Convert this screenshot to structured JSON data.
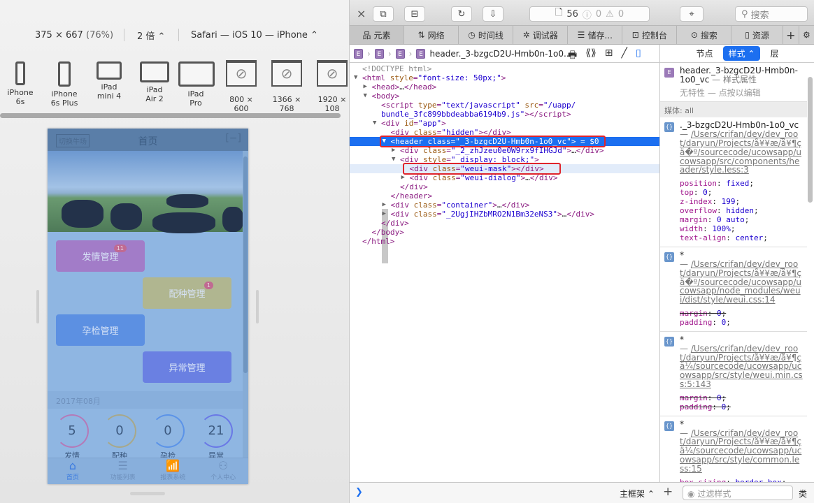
{
  "simulator": {
    "size": "375 × 667",
    "zoom": "(76%)",
    "scale": "2 倍 ⌃",
    "ua": "Safari — iOS 10 — iPhone ⌃",
    "devices": [
      {
        "l1": "iPhone",
        "l2": "6s"
      },
      {
        "l1": "iPhone",
        "l2": "6s Plus"
      },
      {
        "l1": "iPad",
        "l2": "mini 4"
      },
      {
        "l1": "iPad",
        "l2": "Air 2"
      },
      {
        "l1": "iPad",
        "l2": "Pro"
      },
      {
        "l1": "800 × 600",
        "l2": ""
      },
      {
        "l1": "1366 × 768",
        "l2": ""
      },
      {
        "l1": "1920 × 108",
        "l2": ""
      }
    ]
  },
  "app": {
    "switch_label": "切换牛场",
    "title": "首页",
    "logout_icon": "[−]",
    "menu": [
      {
        "label": "发情管理",
        "badge": "11",
        "color": "#a27cc8"
      },
      {
        "label": "配种管理",
        "badge": "1",
        "color": "#b0b690"
      },
      {
        "label": "孕检管理",
        "badge": "",
        "color": "#5c90e2"
      },
      {
        "label": "异常管理",
        "badge": "",
        "color": "#6a80e2"
      }
    ],
    "month": "2017年08月",
    "stats": [
      {
        "value": "5",
        "label": "发情",
        "color": "#b47ab8"
      },
      {
        "value": "0",
        "label": "配种",
        "color": "#a7a88a"
      },
      {
        "value": "0",
        "label": "孕检",
        "color": "#5b93e8"
      },
      {
        "value": "21",
        "label": "异常",
        "color": "#6a78e6"
      }
    ],
    "tabs": [
      {
        "label": "首页",
        "icon": "⌂",
        "active": true
      },
      {
        "label": "功能列表",
        "icon": "☰",
        "active": false
      },
      {
        "label": "报表系统",
        "icon": "📶",
        "active": false
      },
      {
        "label": "个人中心",
        "icon": "⚇",
        "active": false
      }
    ]
  },
  "devtools": {
    "close": "×",
    "resource_count": "56",
    "errors": "0",
    "warnings": "0",
    "search_placeholder": "搜索",
    "tabs": [
      "元素",
      "网络",
      "时间线",
      "调试器",
      "储存...",
      "控制台",
      "搜索",
      "资源"
    ],
    "tab_icons": [
      "品",
      "⇅",
      "◷",
      "✲",
      "☰",
      "⊡",
      "⊙",
      "▯"
    ],
    "breadcrumb_last": "header._3-bzgcD2U-Hmb0n-1o0...",
    "style_tabs": [
      "节点",
      "样式 ⌃",
      "层"
    ],
    "dom_lines": [
      {
        "i": 0,
        "t": [
          [
            "cm",
            "<!DOCTYPE html>"
          ]
        ]
      },
      {
        "i": 0,
        "a": "▼",
        "t": [
          [
            "tg",
            "<html "
          ],
          [
            "at",
            "style"
          ],
          [
            "tg",
            "="
          ],
          [
            "vl",
            "\"font-size: 50px;\""
          ],
          [
            "tg",
            ">"
          ]
        ]
      },
      {
        "i": 1,
        "a": "▶",
        "t": [
          [
            "tg",
            "<head>"
          ],
          [
            "tx",
            "…"
          ],
          [
            "tg",
            "</head>"
          ]
        ]
      },
      {
        "i": 1,
        "a": "▼",
        "t": [
          [
            "tg",
            "<body>"
          ]
        ]
      },
      {
        "i": 2,
        "t": [
          [
            "tg",
            "<script "
          ],
          [
            "at",
            "type"
          ],
          [
            "tg",
            "="
          ],
          [
            "vl",
            "\"text/javascript\""
          ],
          [
            "at",
            " src"
          ],
          [
            "tg",
            "="
          ],
          [
            "vl",
            "\"/uapp/"
          ]
        ]
      },
      {
        "i": 2,
        "t": [
          [
            "vl",
            "bundle_3fc899bbdeabba6194b9.js\""
          ],
          [
            "tg",
            "></script>"
          ]
        ]
      },
      {
        "i": 2,
        "a": "▼",
        "t": [
          [
            "tg",
            "<div "
          ],
          [
            "at",
            "id"
          ],
          [
            "tg",
            "="
          ],
          [
            "vl",
            "\"app\""
          ],
          [
            "tg",
            ">"
          ]
        ]
      },
      {
        "i": 3,
        "t": [
          [
            "tg",
            "<div "
          ],
          [
            "at",
            "class"
          ],
          [
            "tg",
            "="
          ],
          [
            "vl",
            "\"hidden\""
          ],
          [
            "tg",
            "></div>"
          ]
        ]
      },
      {
        "i": 3,
        "a": "▼",
        "sel": true,
        "t": [
          [
            "tg",
            "<header "
          ],
          [
            "at",
            "class"
          ],
          [
            "tg",
            "="
          ],
          [
            "vl",
            "\"_3-bzgcD2U-Hmb0n-1o0_vc\""
          ],
          [
            "tg",
            ">"
          ],
          [
            "dl",
            " = $0"
          ]
        ]
      },
      {
        "i": 4,
        "a": "▶",
        "t": [
          [
            "tg",
            "<div "
          ],
          [
            "at",
            "class"
          ],
          [
            "tg",
            "="
          ],
          [
            "vl",
            "\"_2_zhJzeu0e0W9rx9fIHGJd\""
          ],
          [
            "tg",
            ">"
          ],
          [
            "tx",
            "…"
          ],
          [
            "tg",
            "</div>"
          ]
        ]
      },
      {
        "i": 4,
        "a": "▼",
        "t": [
          [
            "tg",
            "<div "
          ],
          [
            "at",
            "style"
          ],
          [
            "tg",
            "="
          ],
          [
            "vl",
            "\" display: block;\""
          ],
          [
            "tg",
            ">"
          ]
        ]
      },
      {
        "i": 5,
        "hov": true,
        "t": [
          [
            "tg",
            "<div "
          ],
          [
            "at",
            "class"
          ],
          [
            "tg",
            "="
          ],
          [
            "vl",
            "\"weui-mask\""
          ],
          [
            "tg",
            "></div>"
          ]
        ]
      },
      {
        "i": 5,
        "a": "▶",
        "t": [
          [
            "tg",
            "<div "
          ],
          [
            "at",
            "class"
          ],
          [
            "tg",
            "="
          ],
          [
            "vl",
            "\"weui-dialog\""
          ],
          [
            "tg",
            ">"
          ],
          [
            "tx",
            "…"
          ],
          [
            "tg",
            "</div>"
          ]
        ]
      },
      {
        "i": 4,
        "t": [
          [
            "tg",
            "</div>"
          ]
        ]
      },
      {
        "i": 3,
        "t": [
          [
            "tg",
            "</header>"
          ]
        ]
      },
      {
        "i": 3,
        "a": "▶",
        "t": [
          [
            "tg",
            "<div "
          ],
          [
            "at",
            "class"
          ],
          [
            "tg",
            "="
          ],
          [
            "vl",
            "\"container\""
          ],
          [
            "tg",
            ">"
          ],
          [
            "tx",
            "…"
          ],
          [
            "tg",
            "</div>"
          ]
        ]
      },
      {
        "i": 3,
        "a": "▶",
        "t": [
          [
            "tg",
            "<div "
          ],
          [
            "at",
            "class"
          ],
          [
            "tg",
            "="
          ],
          [
            "vl",
            "\"_2UgjIHZbMRO2N1Bm32eNS3\""
          ],
          [
            "tg",
            ">"
          ],
          [
            "tx",
            "…"
          ],
          [
            "tg",
            "</div>"
          ]
        ]
      },
      {
        "i": 2,
        "t": [
          [
            "tg",
            "</div>"
          ]
        ]
      },
      {
        "i": 1,
        "t": [
          [
            "tg",
            "</body>"
          ]
        ]
      },
      {
        "i": 0,
        "t": [
          [
            "tg",
            "</html>"
          ]
        ]
      }
    ],
    "styles": {
      "element_selector": "header._3-bzgcD2U-Hmb0n-1o0_vc",
      "element_suffix": " — 样式属性",
      "no_attrs": "无特性 — 点按以编辑",
      "media": "媒体: all",
      "rules": [
        {
          "selector": "._3-bzgcD2U-Hmb0n-1o0_vc",
          "source": "/Users/crifan/dev/dev_root/daryun/Projects/å¥¥æ/å¥¶çä�º/sourcecode/ucowsapp/ucowsapp/src/components/header/style.less:3",
          "decls": [
            {
              "p": "position",
              "v": "fixed"
            },
            {
              "p": "top",
              "v": "0"
            },
            {
              "p": "z-index",
              "v": "199"
            },
            {
              "p": "overflow",
              "v": "hidden"
            },
            {
              "p": "margin",
              "v": "0 auto"
            },
            {
              "p": "width",
              "v": "100%"
            },
            {
              "p": "text-align",
              "v": "center"
            }
          ]
        },
        {
          "selector": "*",
          "source": "/Users/crifan/dev/dev_root/daryun/Projects/å¥¥æ/å¥¶çä�º/sourcecode/ucowsapp/ucowsapp/node_modules/weui/dist/style/weui.css:14",
          "decls": [
            {
              "p": "margin",
              "v": "0",
              "s": true
            },
            {
              "p": "padding",
              "v": "0"
            }
          ]
        },
        {
          "selector": "*",
          "source": "/Users/crifan/dev/dev_root/daryun/Projects/å¥¥æ/å¥¶çä¼/sourcecode/ucowsapp/ucowsapp/src/style/weui.min.css:5:143",
          "decls": [
            {
              "p": "margin",
              "v": "0",
              "s": true
            },
            {
              "p": "padding",
              "v": "0",
              "s": true
            }
          ]
        },
        {
          "selector": "*",
          "source": "/Users/crifan/dev/dev_root/daryun/Projects/å¥¥æ/å¥¶çä¼/sourcecode/ucowsapp/ucowsapp/src/style/common.less:15",
          "decls": [
            {
              "p": "box-sizing",
              "v": "border-box"
            }
          ]
        }
      ]
    },
    "frame_select": "主框架 ⌃",
    "filter_placeholder": "过滤样式",
    "classes_btn": "类",
    "console_prompt": "❯"
  }
}
